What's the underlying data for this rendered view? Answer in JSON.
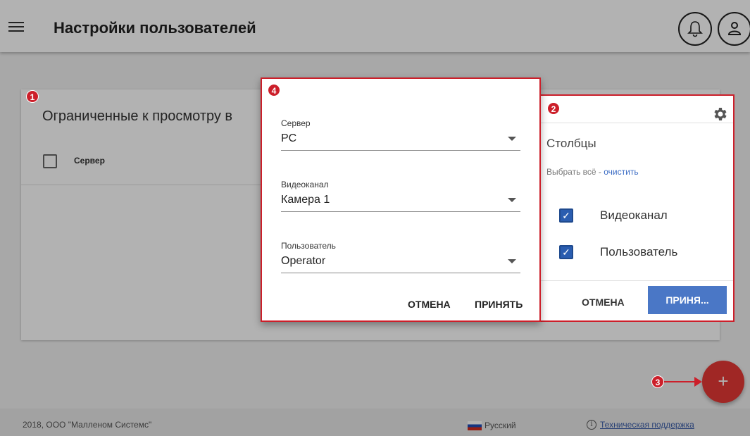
{
  "header": {
    "title": "Настройки пользователей",
    "menu_icon": "menu-icon",
    "notifications_icon": "bell-icon",
    "user_icon": "user-icon"
  },
  "card": {
    "title": "Ограниченные к просмотру в",
    "column_header": "Сервер"
  },
  "columns_panel": {
    "title": "Столбцы",
    "select_all": "Выбрать всё",
    "separator": " - ",
    "clear": "очистить",
    "items": [
      {
        "label": "Видеоканал",
        "checked": true
      },
      {
        "label": "Пользователь",
        "checked": true
      }
    ],
    "cancel_label": "ОТМЕНА",
    "accept_label": "ПРИНЯ...",
    "icon": "gear-icon"
  },
  "dialog": {
    "fields": [
      {
        "label": "Сервер",
        "value": "PC"
      },
      {
        "label": "Видеоканал",
        "value": "Камера 1"
      },
      {
        "label": "Пользователь",
        "value": "Operator"
      }
    ],
    "cancel_label": "ОТМЕНА",
    "accept_label": "ПРИНЯТЬ"
  },
  "fab": {
    "label": "+"
  },
  "markers": [
    "1",
    "2",
    "3",
    "4"
  ],
  "footer": {
    "copyright": "2018, ООО \"Малленом Системс\"",
    "language": "Русский",
    "support": "Техническая поддержка"
  },
  "colors": {
    "annotation_red": "#cc1f2a",
    "fab_red": "#e53935",
    "accept_blue": "#4a77c6",
    "checkbox_blue": "#2a5db0"
  }
}
